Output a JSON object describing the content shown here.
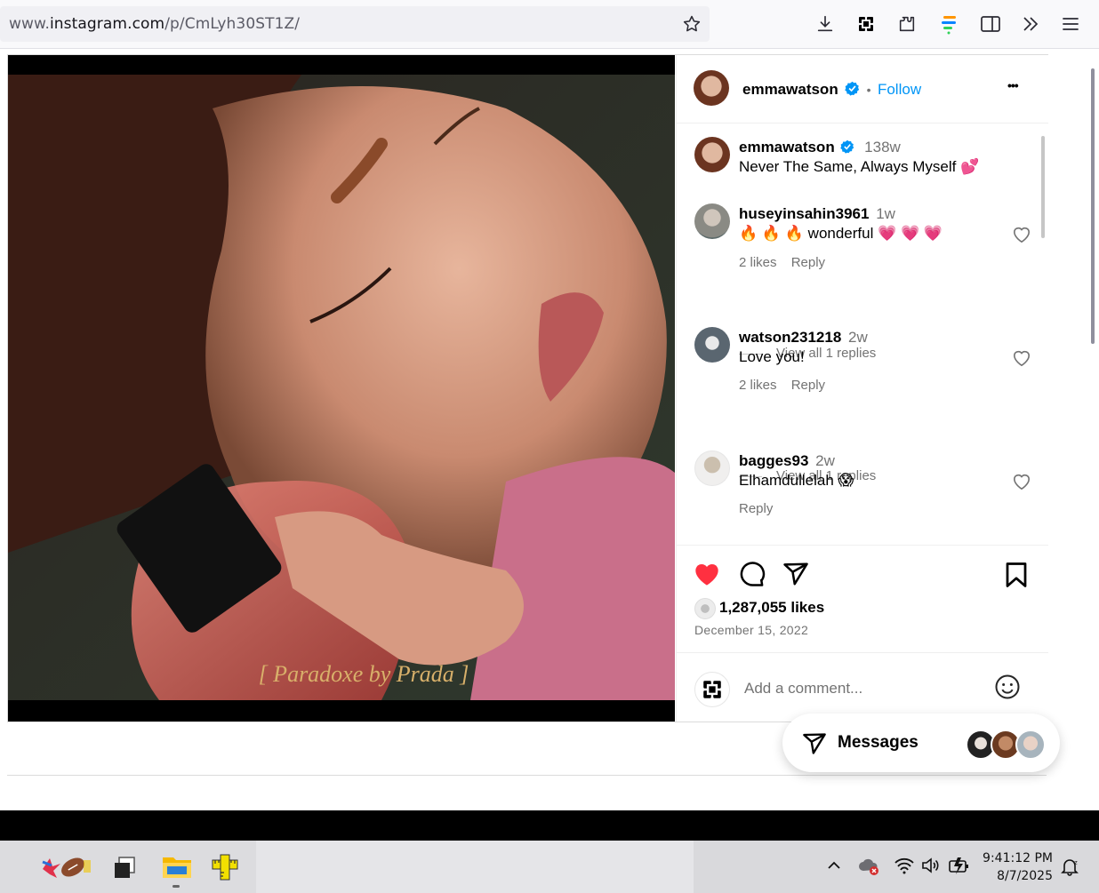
{
  "browser": {
    "url_prefix": "www.",
    "url_domain": "instagram.com",
    "url_path": "/p/CmLyh30ST1Z/"
  },
  "post": {
    "caption_overlay": "[ Paradoxe by Prada ]",
    "header": {
      "username": "emmawatson",
      "separator": "•",
      "follow_label": "Follow",
      "more_label": "•••"
    },
    "caption": {
      "username": "emmawatson",
      "time": "138w",
      "text": "Never The Same, Always Myself 💕"
    },
    "comments": [
      {
        "username": "huseyinsahin3961",
        "time": "1w",
        "text": "🔥 🔥 🔥 wonderful 💗 💗 💗",
        "likes": "2 likes",
        "reply": "Reply",
        "view_replies": "View all 1 replies"
      },
      {
        "username": "watson231218",
        "time": "2w",
        "text": "Love you!",
        "likes": "2 likes",
        "reply": "Reply",
        "view_replies": "View all 1 replies"
      },
      {
        "username": "bagges93",
        "time": "2w",
        "text": "Elhamdullelah 😱",
        "reply": "Reply"
      }
    ],
    "likes_count": "1,287,055 likes",
    "date": "December 15, 2022",
    "add_comment_placeholder": "Add a comment..."
  },
  "messages": {
    "label": "Messages"
  },
  "taskbar": {
    "time": "9:41:12 PM",
    "date": "8/7/2025"
  },
  "colors": {
    "accent_blue": "#0095f6",
    "like_red": "#ff3040",
    "muted": "#737373"
  }
}
